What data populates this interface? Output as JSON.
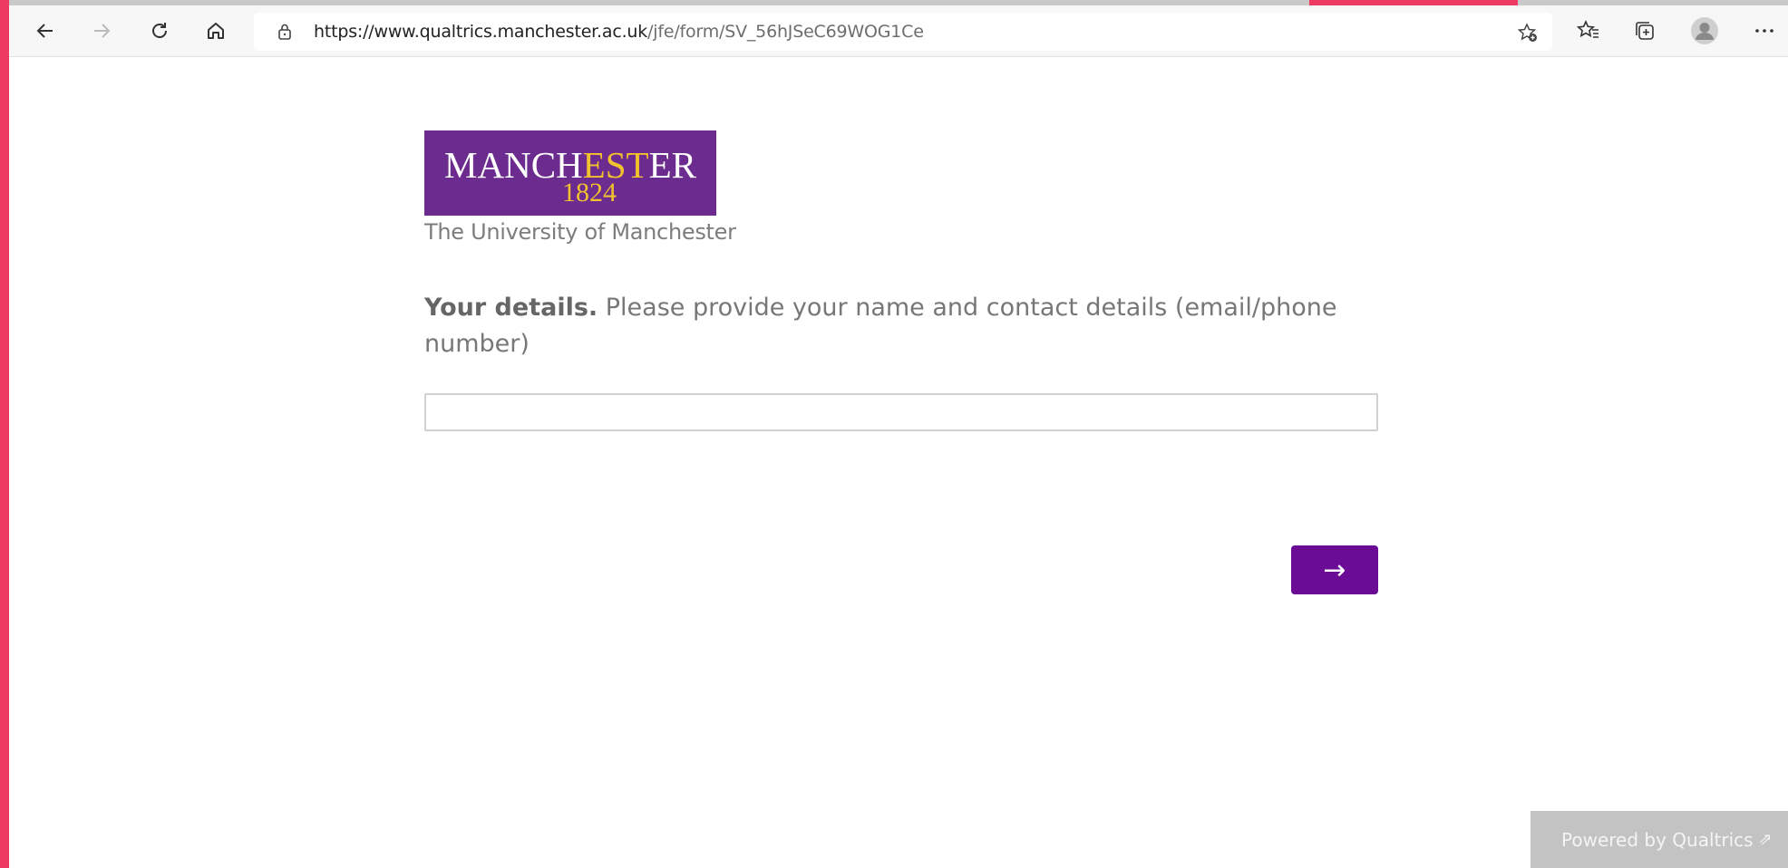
{
  "browser": {
    "url_host": "https://www.qualtrics.manchester.ac.uk",
    "url_path": "/jfe/form/SV_56hJSeC69WOG1Ce",
    "icons": [
      "back-icon",
      "forward-icon",
      "refresh-icon",
      "home-icon",
      "lock-icon",
      "add-favorite-icon",
      "favorites-icon",
      "collections-icon",
      "profile-icon",
      "more-icon"
    ]
  },
  "logo": {
    "word_part1": "MANCH",
    "word_part2": "EST",
    "word_part3": "ER",
    "year": "1824",
    "subtitle": "The University of Manchester",
    "colors": {
      "box": "#6c2b8f",
      "gold": "#f2c12e"
    }
  },
  "question": {
    "bold_label": "Your details.",
    "text": " Please provide your name and contact details (email/phone number)"
  },
  "answer": {
    "value": "",
    "placeholder": ""
  },
  "next_button": {
    "label": "→",
    "color": "#6a0c96"
  },
  "footer": {
    "powered_label": "Powered by Qualtrics",
    "external_icon": "⇗"
  },
  "accent": "#ee3a63"
}
